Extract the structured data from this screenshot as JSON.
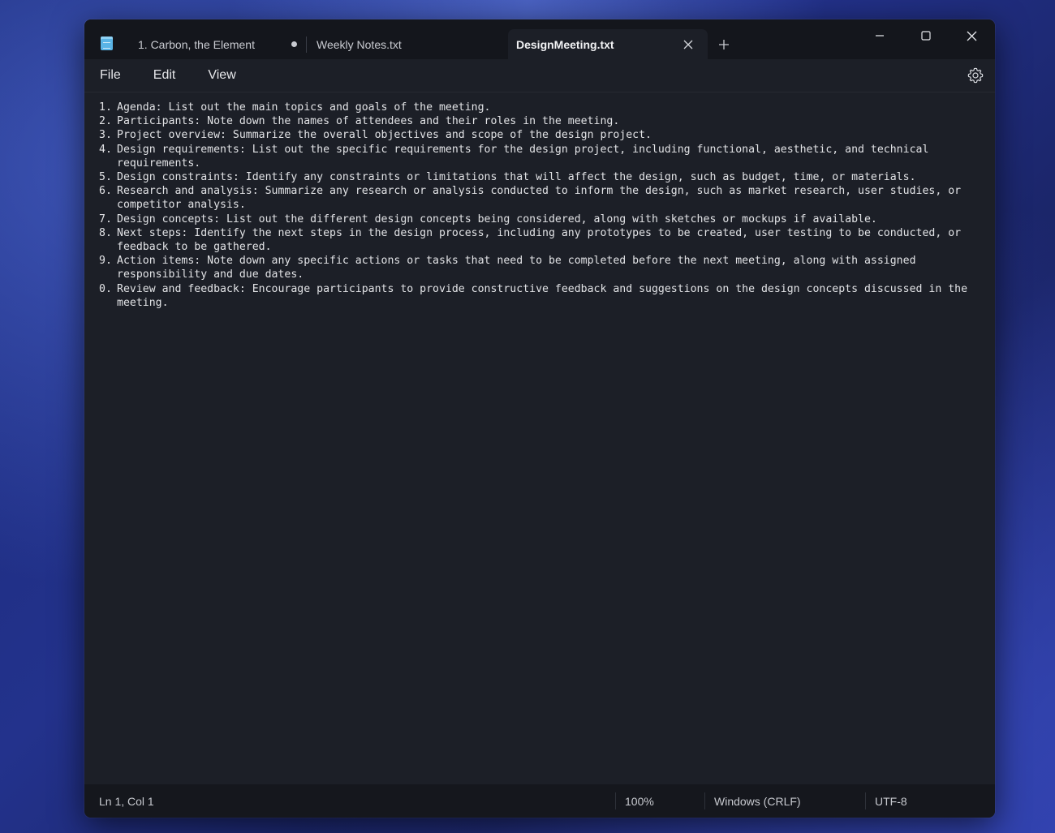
{
  "tabs": [
    {
      "label": "1. Carbon, the Element",
      "unsaved": true
    },
    {
      "label": "Weekly Notes.txt"
    },
    {
      "label": "DesignMeeting.txt",
      "active": true
    }
  ],
  "menu": {
    "file": "File",
    "edit": "Edit",
    "view": "View"
  },
  "document": {
    "lines": [
      {
        "n": "1.",
        "text": "Agenda: List out the main topics and goals of the meeting."
      },
      {
        "n": "2.",
        "text": "Participants: Note down the names of attendees and their roles in the meeting."
      },
      {
        "n": "3.",
        "text": "Project overview: Summarize the overall objectives and scope of the design project."
      },
      {
        "n": "4.",
        "text": "Design requirements: List out the specific requirements for the design project, including functional, aesthetic, and technical requirements."
      },
      {
        "n": "5.",
        "text": "Design constraints: Identify any constraints or limitations that will affect the design, such as budget, time, or materials."
      },
      {
        "n": "6.",
        "text": "Research and analysis: Summarize any research or analysis conducted to inform the design, such as market research, user studies, or competitor analysis."
      },
      {
        "n": "7.",
        "text": "Design concepts: List out the different design concepts being considered, along with sketches or mockups if available."
      },
      {
        "n": "8.",
        "text": "Next steps: Identify the next steps in the design process, including any prototypes to be created, user testing to be conducted, or feedback to be gathered."
      },
      {
        "n": "9.",
        "text": "Action items: Note down any specific actions or tasks that need to be completed before the next meeting, along with assigned responsibility and due dates."
      },
      {
        "n": "0.",
        "text": "Review and feedback: Encourage participants to provide constructive feedback and suggestions on the design concepts discussed in the meeting."
      }
    ]
  },
  "status": {
    "position": "Ln 1, Col 1",
    "zoom": "100%",
    "line_ending": "Windows (CRLF)",
    "encoding": "UTF-8"
  },
  "icons": {
    "app": "notepad-icon",
    "settings": "gear-icon",
    "close_tab": "close-icon",
    "new_tab": "plus-icon",
    "minimize": "minimize-icon",
    "maximize": "maximize-icon",
    "close_window": "close-icon"
  }
}
